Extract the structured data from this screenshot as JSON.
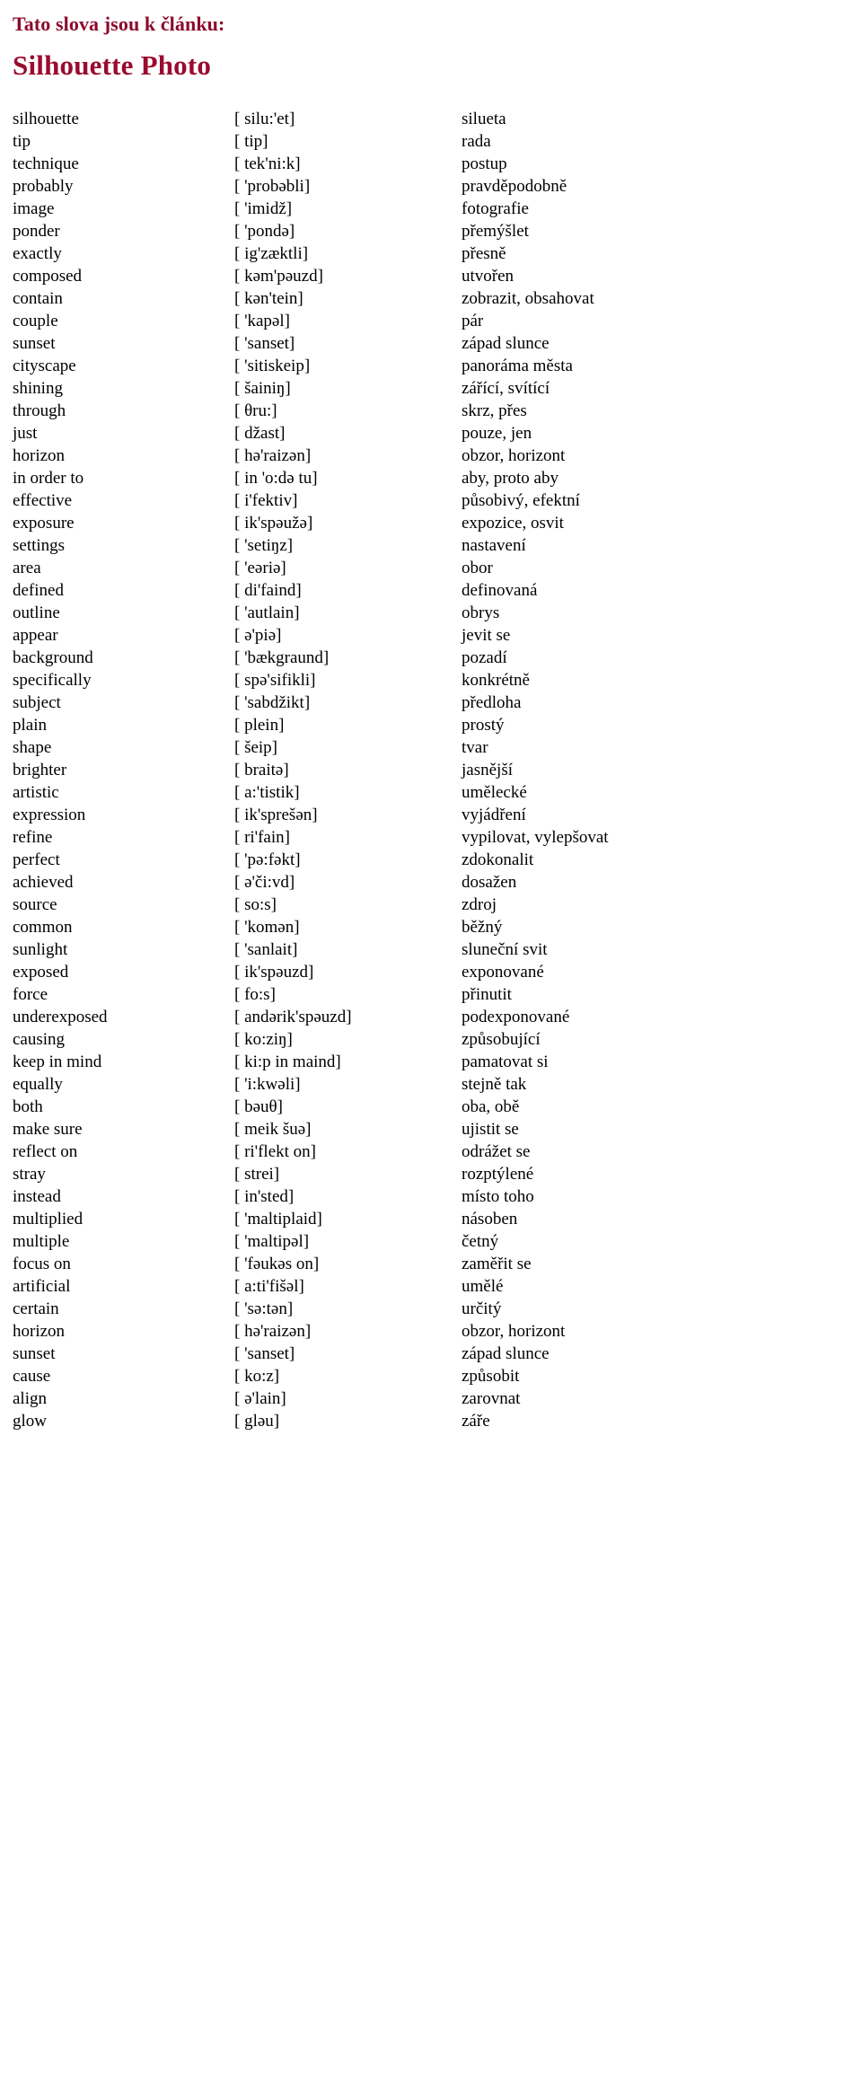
{
  "header": {
    "kicker": "Tato slova jsou k článku:",
    "title": "Silhouette Photo",
    "kicker_color": "#8c0a2d",
    "title_color": "#9b0b2e"
  },
  "vocab": {
    "rows": [
      {
        "word": "silhouette",
        "ipa": "[ silu:'et]",
        "translation": "silueta"
      },
      {
        "word": "tip",
        "ipa": "[ tip]",
        "translation": "rada"
      },
      {
        "word": "technique",
        "ipa": "[ tek'ni:k]",
        "translation": "postup"
      },
      {
        "word": "probably",
        "ipa": "[ 'probəbli]",
        "translation": "pravděpodobně"
      },
      {
        "word": "image",
        "ipa": "[ 'imidž]",
        "translation": "fotografie"
      },
      {
        "word": "ponder",
        "ipa": "[ 'pondə]",
        "translation": "přemýšlet"
      },
      {
        "word": "exactly",
        "ipa": "[ ig'zæktli]",
        "translation": "přesně"
      },
      {
        "word": "composed",
        "ipa": "[ kəm'pəuzd]",
        "translation": "utvořen"
      },
      {
        "word": "contain",
        "ipa": "[ kən'tein]",
        "translation": "zobrazit, obsahovat"
      },
      {
        "word": "couple",
        "ipa": "[ 'kapəl]",
        "translation": "pár"
      },
      {
        "word": "sunset",
        "ipa": "[ 'sanset]",
        "translation": "západ slunce"
      },
      {
        "word": "cityscape",
        "ipa": "[ 'sitiskeip]",
        "translation": "panoráma města"
      },
      {
        "word": "shining",
        "ipa": "[ šainiŋ]",
        "translation": "zářící, svítící"
      },
      {
        "word": "through",
        "ipa": "[ θru:]",
        "translation": "skrz, přes"
      },
      {
        "word": "just",
        "ipa": "[ džast]",
        "translation": "pouze, jen"
      },
      {
        "word": "horizon",
        "ipa": "[ hə'raizən]",
        "translation": "obzor, horizont"
      },
      {
        "word": "in order to",
        "ipa": "[ in 'o:də tu]",
        "translation": "aby, proto aby"
      },
      {
        "word": "effective",
        "ipa": "[ i'fektiv]",
        "translation": "působivý, efektní"
      },
      {
        "word": "exposure",
        "ipa": "[ ik'spəužə]",
        "translation": "expozice, osvit"
      },
      {
        "word": "settings",
        "ipa": "[ 'setiŋz]",
        "translation": "nastavení"
      },
      {
        "word": "area",
        "ipa": "[ 'eəriə]",
        "translation": "obor"
      },
      {
        "word": "defined",
        "ipa": "[ di'faind]",
        "translation": "definovaná"
      },
      {
        "word": "outline",
        "ipa": "[ 'autlain]",
        "translation": "obrys"
      },
      {
        "word": "appear",
        "ipa": "[ ə'piə]",
        "translation": "jevit se"
      },
      {
        "word": "background",
        "ipa": "[ 'bækgraund]",
        "translation": "pozadí"
      },
      {
        "word": "specifically",
        "ipa": "[ spə'sifikli]",
        "translation": "konkrétně"
      },
      {
        "word": "subject",
        "ipa": "[ 'sabdžikt]",
        "translation": "předloha"
      },
      {
        "word": "plain",
        "ipa": "[ plein]",
        "translation": "prostý"
      },
      {
        "word": "shape",
        "ipa": "[ šeip]",
        "translation": "tvar"
      },
      {
        "word": "brighter",
        "ipa": "[ braitə]",
        "translation": "jasnější"
      },
      {
        "word": "artistic",
        "ipa": "[ a:'tistik]",
        "translation": "umělecké"
      },
      {
        "word": "expression",
        "ipa": "[ ik'sprešən]",
        "translation": "vyjádření"
      },
      {
        "word": "refine",
        "ipa": "[ ri'fain]",
        "translation": "vypilovat, vylepšovat"
      },
      {
        "word": "perfect",
        "ipa": "[ 'pə:fəkt]",
        "translation": "zdokonalit"
      },
      {
        "word": "achieved",
        "ipa": "[ ə'či:vd]",
        "translation": "dosažen"
      },
      {
        "word": "source",
        "ipa": "[ so:s]",
        "translation": "zdroj"
      },
      {
        "word": "common",
        "ipa": "[ 'komən]",
        "translation": "běžný"
      },
      {
        "word": "sunlight",
        "ipa": "[ 'sanlait]",
        "translation": "sluneční svit"
      },
      {
        "word": "exposed",
        "ipa": "[ ik'spəuzd]",
        "translation": "exponované"
      },
      {
        "word": "force",
        "ipa": "[ fo:s]",
        "translation": "přinutit"
      },
      {
        "word": "underexposed",
        "ipa": "[ andərik'spəuzd]",
        "translation": "podexponované"
      },
      {
        "word": "causing",
        "ipa": "[ ko:ziŋ]",
        "translation": "způsobující"
      },
      {
        "word": "keep in mind",
        "ipa": "[ ki:p in maind]",
        "translation": "pamatovat si"
      },
      {
        "word": "equally",
        "ipa": "[ 'i:kwəli]",
        "translation": "stejně tak"
      },
      {
        "word": "both",
        "ipa": "[ bəuθ]",
        "translation": "oba, obě"
      },
      {
        "word": "make sure",
        "ipa": "[ meik šuə]",
        "translation": "ujistit se"
      },
      {
        "word": "reflect on",
        "ipa": "[ ri'flekt on]",
        "translation": "odrážet se"
      },
      {
        "word": "stray",
        "ipa": "[ strei]",
        "translation": "rozptýlené"
      },
      {
        "word": "instead",
        "ipa": "[ in'sted]",
        "translation": "místo toho"
      },
      {
        "word": "multiplied",
        "ipa": "[ 'maltiplaid]",
        "translation": "násoben"
      },
      {
        "word": "multiple",
        "ipa": "[ 'maltipəl]",
        "translation": "četný"
      },
      {
        "word": "focus on",
        "ipa": "[ 'fəukəs on]",
        "translation": "zaměřit se"
      },
      {
        "word": "artificial",
        "ipa": "[ a:ti'fišəl]",
        "translation": "umělé"
      },
      {
        "word": "certain",
        "ipa": "[ 'sə:tən]",
        "translation": "určitý"
      },
      {
        "word": "horizon",
        "ipa": "[ hə'raizən]",
        "translation": "obzor, horizont"
      },
      {
        "word": "sunset",
        "ipa": "[ 'sanset]",
        "translation": "západ slunce"
      },
      {
        "word": "cause",
        "ipa": "[ ko:z]",
        "translation": "způsobit"
      },
      {
        "word": "align",
        "ipa": "[ ə'lain]",
        "translation": "zarovnat"
      },
      {
        "word": "glow",
        "ipa": "[ gləu]",
        "translation": "záře"
      }
    ]
  }
}
